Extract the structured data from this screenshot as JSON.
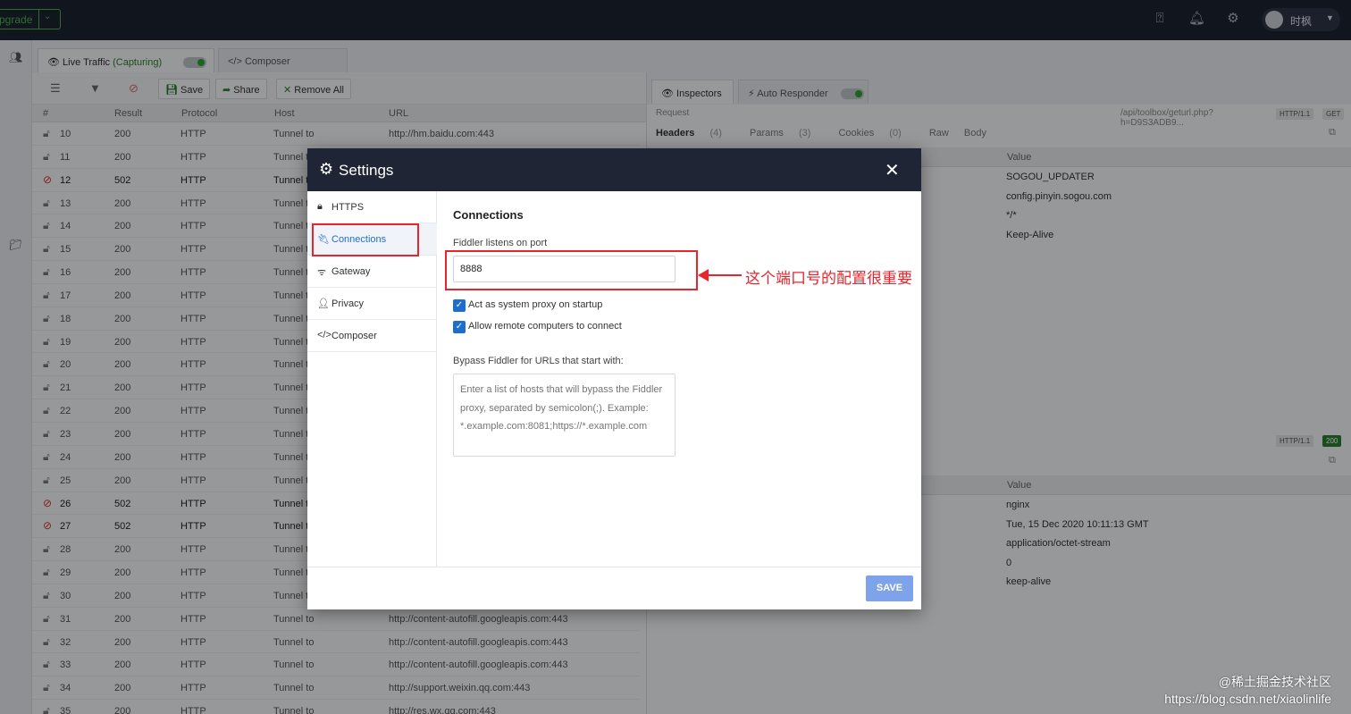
{
  "topbar": {
    "upgrade_label": "pgrade",
    "user_name": "时枫"
  },
  "tabs": {
    "live_traffic": "Live Traffic",
    "capturing": "(Capturing)",
    "composer": "Composer"
  },
  "toolbar": {
    "save": "Save",
    "share": "Share",
    "remove_all": "Remove All"
  },
  "grid": {
    "headers": [
      "#",
      "Result",
      "Protocol",
      "Host",
      "URL"
    ],
    "rows": [
      {
        "id": "10",
        "result": "200",
        "protocol": "HTTP",
        "host": "Tunnel to",
        "url": "http://hm.baidu.com:443"
      },
      {
        "id": "11",
        "result": "200",
        "protocol": "HTTP",
        "host": "Tunnel t",
        "url": ""
      },
      {
        "id": "12",
        "result": "502",
        "protocol": "HTTP",
        "host": "Tunnel t",
        "url": ""
      },
      {
        "id": "13",
        "result": "200",
        "protocol": "HTTP",
        "host": "Tunnel t",
        "url": ""
      },
      {
        "id": "14",
        "result": "200",
        "protocol": "HTTP",
        "host": "Tunnel t",
        "url": ""
      },
      {
        "id": "15",
        "result": "200",
        "protocol": "HTTP",
        "host": "Tunnel t",
        "url": ""
      },
      {
        "id": "16",
        "result": "200",
        "protocol": "HTTP",
        "host": "Tunnel t",
        "url": ""
      },
      {
        "id": "17",
        "result": "200",
        "protocol": "HTTP",
        "host": "Tunnel t",
        "url": ""
      },
      {
        "id": "18",
        "result": "200",
        "protocol": "HTTP",
        "host": "Tunnel t",
        "url": ""
      },
      {
        "id": "19",
        "result": "200",
        "protocol": "HTTP",
        "host": "Tunnel t",
        "url": ""
      },
      {
        "id": "20",
        "result": "200",
        "protocol": "HTTP",
        "host": "Tunnel t",
        "url": ""
      },
      {
        "id": "21",
        "result": "200",
        "protocol": "HTTP",
        "host": "Tunnel t",
        "url": ""
      },
      {
        "id": "22",
        "result": "200",
        "protocol": "HTTP",
        "host": "Tunnel t",
        "url": ""
      },
      {
        "id": "23",
        "result": "200",
        "protocol": "HTTP",
        "host": "Tunnel t",
        "url": ""
      },
      {
        "id": "24",
        "result": "200",
        "protocol": "HTTP",
        "host": "Tunnel t",
        "url": ""
      },
      {
        "id": "25",
        "result": "200",
        "protocol": "HTTP",
        "host": "Tunnel t",
        "url": ""
      },
      {
        "id": "26",
        "result": "502",
        "protocol": "HTTP",
        "host": "Tunnel t",
        "url": ""
      },
      {
        "id": "27",
        "result": "502",
        "protocol": "HTTP",
        "host": "Tunnel t",
        "url": ""
      },
      {
        "id": "28",
        "result": "200",
        "protocol": "HTTP",
        "host": "Tunnel t",
        "url": ""
      },
      {
        "id": "29",
        "result": "200",
        "protocol": "HTTP",
        "host": "Tunnel t",
        "url": ""
      },
      {
        "id": "30",
        "result": "200",
        "protocol": "HTTP",
        "host": "Tunnel t",
        "url": ""
      },
      {
        "id": "31",
        "result": "200",
        "protocol": "HTTP",
        "host": "Tunnel to",
        "url": "http://content-autofill.googleapis.com:443"
      },
      {
        "id": "32",
        "result": "200",
        "protocol": "HTTP",
        "host": "Tunnel to",
        "url": "http://content-autofill.googleapis.com:443"
      },
      {
        "id": "33",
        "result": "200",
        "protocol": "HTTP",
        "host": "Tunnel to",
        "url": "http://content-autofill.googleapis.com:443"
      },
      {
        "id": "34",
        "result": "200",
        "protocol": "HTTP",
        "host": "Tunnel to",
        "url": "http://support.weixin.qq.com:443"
      },
      {
        "id": "35",
        "result": "200",
        "protocol": "HTTP",
        "host": "Tunnel to",
        "url": "http://res.wx.qq.com:443"
      }
    ]
  },
  "right": {
    "tab_inspectors": "Inspectors",
    "tab_auto_responder": "Auto Responder",
    "request_label": "Request",
    "request_url": "/api/toolbox/geturl.php?h=D9S3ADB9...",
    "http_version": "HTTP/1.1",
    "method": "GET",
    "subtabs": {
      "headers": "Headers",
      "headers_count": "(4)",
      "params": "Params",
      "params_count": "(3)",
      "cookies": "Cookies",
      "cookies_count": "(0)",
      "raw": "Raw",
      "body": "Body"
    },
    "value_header": "Value",
    "request_values": [
      "SOGOU_UPDATER",
      "config.pinyin.sogou.com",
      "*/*",
      "Keep-Alive"
    ],
    "response_http": "HTTP/1.1",
    "response_status": "200",
    "response_values": [
      "nginx",
      "Tue, 15 Dec 2020 10:11:13 GMT",
      "application/octet-stream",
      "0",
      "keep-alive"
    ]
  },
  "settings": {
    "title": "Settings",
    "close": "✕",
    "sidebar": [
      "HTTPS",
      "Connections",
      "Gateway",
      "Privacy",
      "Composer"
    ],
    "section_title": "Connections",
    "port_label": "Fiddler listens on port",
    "port_value": "8888",
    "check_system_proxy": "Act as system proxy on startup",
    "check_remote": "Allow remote computers to connect",
    "bypass_label": "Bypass Fiddler for URLs that start with:",
    "bypass_placeholder": "Enter a list of hosts that will bypass the Fiddler proxy, separated by semicolon(;). Example: *.example.com:8081;https://*.example.com",
    "save": "SAVE"
  },
  "annotation": "这个端口号的配置很重要",
  "watermark": {
    "line1": "@稀土掘金技术社区",
    "line2": "https://blog.csdn.net/xiaolinlife"
  },
  "colors": {
    "accent": "#1e6ecf",
    "annotation_red": "#e8252c",
    "topbar": "#1c2230",
    "save_button": "#7ea3ea"
  }
}
